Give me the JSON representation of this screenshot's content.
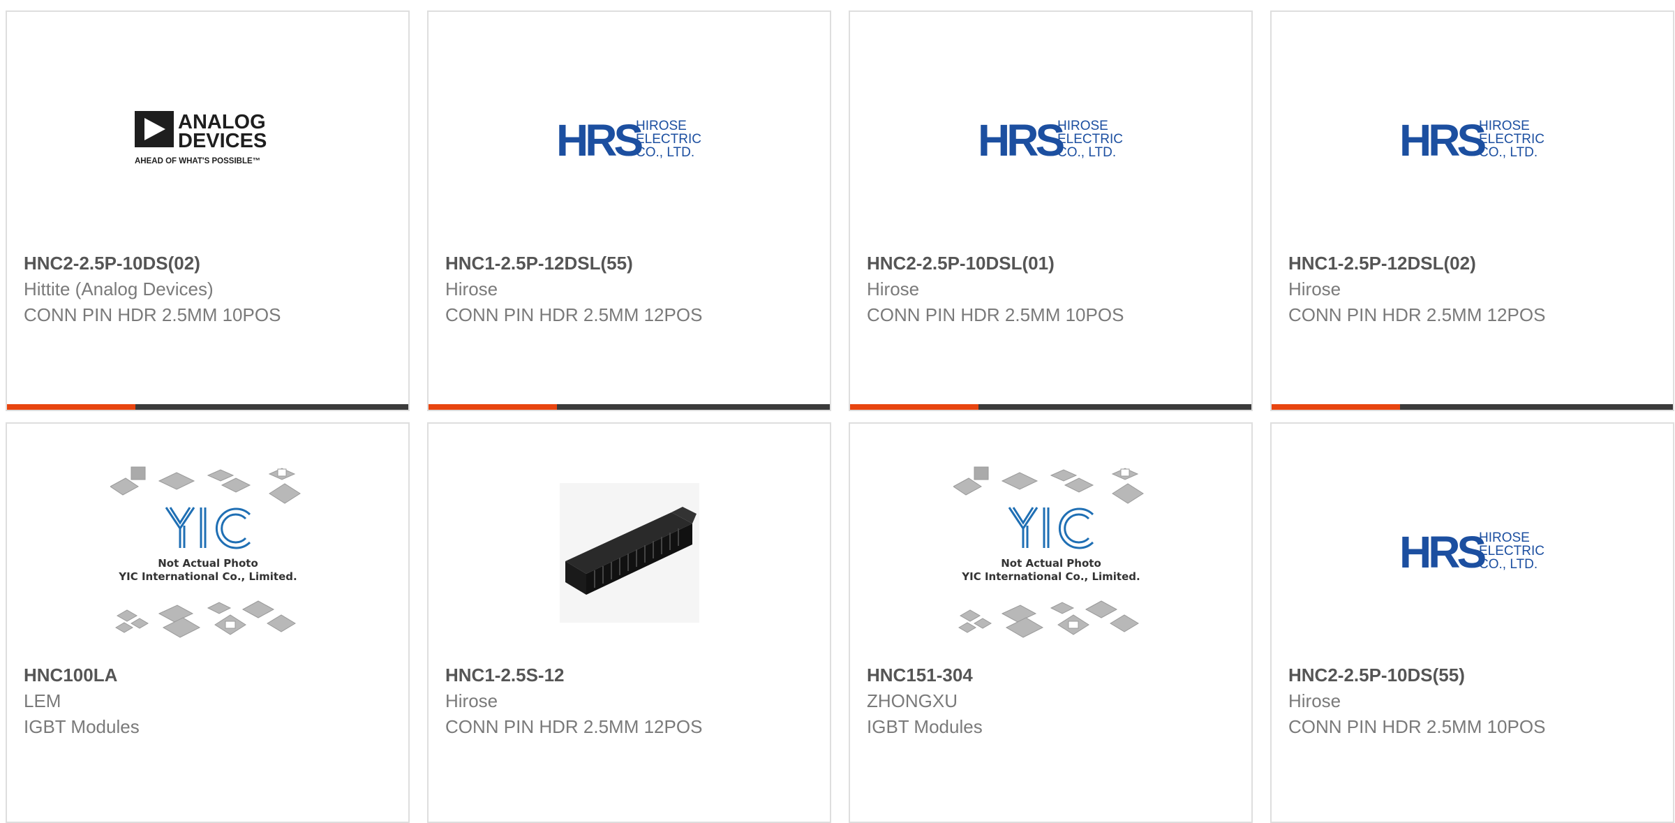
{
  "theme": {
    "accent": "#e84510",
    "bar_track": "#3b3b3b",
    "hrs_blue": "#1c4fa0",
    "border": "#dedede"
  },
  "cards": [
    {
      "part": "HNC2-2.5P-10DS(02)",
      "brand": "Hittite (Analog Devices)",
      "desc": "CONN PIN HDR 2.5MM 10POS",
      "logo": "analog-devices-logo",
      "logo_text": [
        "ANALOG",
        "DEVICES",
        "AHEAD OF WHAT'S POSSIBLE™"
      ],
      "progress": 0.32
    },
    {
      "part": "HNC1-2.5P-12DSL(55)",
      "brand": "Hirose",
      "desc": "CONN PIN HDR 2.5MM 12POS",
      "logo": "hirose-logo",
      "logo_text": [
        "HRS",
        "HIROSE",
        "ELECTRIC",
        "CO., LTD."
      ],
      "progress": 0.32
    },
    {
      "part": "HNC2-2.5P-10DSL(01)",
      "brand": "Hirose",
      "desc": "CONN PIN HDR 2.5MM 10POS",
      "logo": "hirose-logo",
      "logo_text": [
        "HRS",
        "HIROSE",
        "ELECTRIC",
        "CO., LTD."
      ],
      "progress": 0.32
    },
    {
      "part": "HNC1-2.5P-12DSL(02)",
      "brand": "Hirose",
      "desc": "CONN PIN HDR 2.5MM 12POS",
      "logo": "hirose-logo",
      "logo_text": [
        "HRS",
        "HIROSE",
        "ELECTRIC",
        "CO., LTD."
      ],
      "progress": 0.32
    },
    {
      "part": "HNC100LA",
      "brand": "LEM",
      "desc": "IGBT Modules",
      "logo": "yic-placeholder",
      "logo_text": [
        "YIC",
        "Not Actual Photo",
        "YIC International Co., Limited."
      ]
    },
    {
      "part": "HNC1-2.5S-12",
      "brand": "Hirose",
      "desc": "CONN PIN HDR 2.5MM 12POS",
      "logo": "connector-photo"
    },
    {
      "part": "HNC151-304",
      "brand": "ZHONGXU",
      "desc": "IGBT Modules",
      "logo": "yic-placeholder",
      "logo_text": [
        "YIC",
        "Not Actual Photo",
        "YIC International Co., Limited."
      ]
    },
    {
      "part": "HNC2-2.5P-10DS(55)",
      "brand": "Hirose",
      "desc": "CONN PIN HDR 2.5MM 10POS",
      "logo": "hirose-logo",
      "logo_text": [
        "HRS",
        "HIROSE",
        "ELECTRIC",
        "CO., LTD."
      ]
    }
  ]
}
